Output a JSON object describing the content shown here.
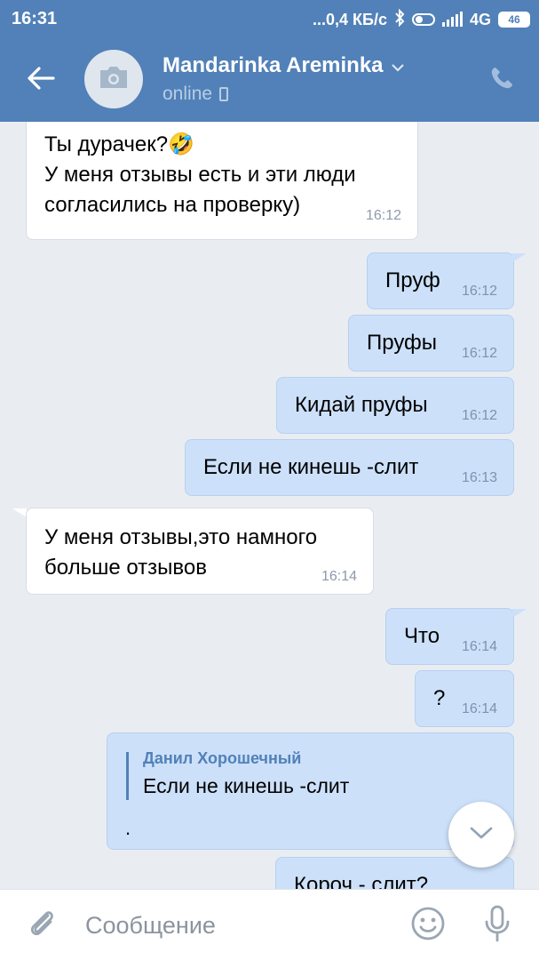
{
  "status_bar": {
    "time": "16:31",
    "network_speed": "...0,4 КБ/с",
    "network_type": "4G",
    "battery": "46",
    "icons": [
      "toggle-icon",
      "bluetooth-icon",
      "signal-icon",
      "battery-icon"
    ]
  },
  "header": {
    "contact_name": "Mandarinka Areminka",
    "status": "online",
    "icons": [
      "back-arrow-icon",
      "camera-icon",
      "chevron-down-icon",
      "mobile-device-icon",
      "phone-icon"
    ]
  },
  "messages": [
    {
      "direction": "in",
      "lines": [
        "Ты дурачек?🤣",
        "У меня отзывы есть и эти люди",
        "согласились на проверку)"
      ],
      "time": "16:12"
    },
    {
      "direction": "out",
      "lines": [
        "Пруф"
      ],
      "time": "16:12"
    },
    {
      "direction": "out",
      "lines": [
        "Пруфы"
      ],
      "time": "16:12"
    },
    {
      "direction": "out",
      "lines": [
        "Кидай пруфы"
      ],
      "time": "16:12"
    },
    {
      "direction": "out",
      "lines": [
        "Если не кинешь -слит"
      ],
      "time": "16:13"
    },
    {
      "direction": "in",
      "lines": [
        "У меня отзывы,это намного",
        "больше отзывов"
      ],
      "time": "16:14"
    },
    {
      "direction": "out",
      "lines": [
        "Что"
      ],
      "time": "16:14"
    },
    {
      "direction": "out",
      "lines": [
        "?"
      ],
      "time": "16:14"
    },
    {
      "direction": "out",
      "reply": {
        "author": "Данил Хорошечный",
        "text": "Если не кинешь -слит"
      },
      "lines": [
        "."
      ],
      "time": ""
    },
    {
      "direction": "out",
      "lines": [
        "Короч - слит?"
      ],
      "time": ""
    }
  ],
  "composer": {
    "placeholder": "Сообщение",
    "icons": [
      "paperclip-icon",
      "emoji-icon",
      "microphone-icon"
    ]
  },
  "colors": {
    "header": "#5181b8",
    "background": "#e9edf2",
    "incoming_bubble": "#ffffff",
    "outgoing_bubble": "#cce0f9",
    "accent": "#5181b8"
  }
}
